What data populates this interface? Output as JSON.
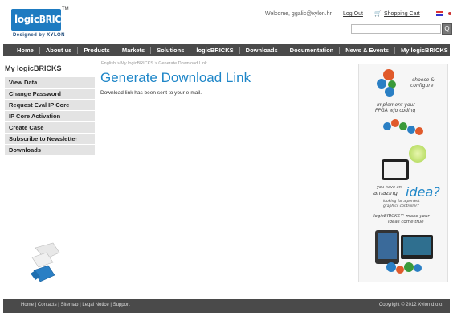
{
  "header": {
    "logo_text_logic": "logic",
    "logo_text_bricks": "BRICKS",
    "logo_tm": "TM",
    "logo_subtitle": "Designed by XYLON",
    "welcome": "Welcome, ggalic@xylon.hr",
    "logout": "Log Out",
    "cart": "Shopping Cart",
    "search_button": "Q"
  },
  "nav": {
    "items": [
      "Home",
      "About us",
      "Products",
      "Markets",
      "Solutions",
      "logicBRICKS",
      "Downloads",
      "Documentation",
      "News & Events",
      "My logicBRICKS"
    ]
  },
  "sidebar": {
    "title": "My logicBRICKS",
    "items": [
      "View Data",
      "Change Password",
      "Request Eval IP Core",
      "IP Core Activation",
      "Create Case",
      "Subscribe to Newsletter",
      "Downloads"
    ]
  },
  "main": {
    "breadcrumb": "English > My logicBRICKS > Generate Download Link",
    "title": "Generate Download Link",
    "message": "Download link has been sent to your e-mail."
  },
  "banner": {
    "line1": "choose &",
    "line2": "configure",
    "line3": "implement your",
    "line4": "FPGA w/o coding",
    "line5": "you have an",
    "line6": "amazing",
    "line7": "idea?",
    "line8": "looking for a perfect",
    "line9": "graphics controller?",
    "line10": "logicBRICKS™ make your",
    "line11": "ideas come true"
  },
  "footer": {
    "links": "Home | Contacts | Sitemap | Legal Notice | Support",
    "copyright": "Copyright © 2012 Xylon d.o.o."
  },
  "colors": {
    "accent": "#1e86c8",
    "nav_bg": "#4a4a4a",
    "sidebar_bg": "#e3e3e3"
  }
}
